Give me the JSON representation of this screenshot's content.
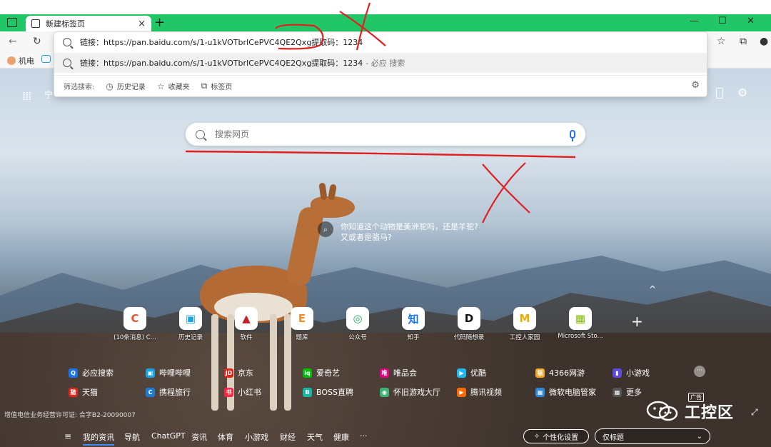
{
  "tab": {
    "title": "新建标签页",
    "close": "×",
    "new": "+"
  },
  "window_controls": {
    "minimize": "—",
    "maximize": "☐",
    "close": "✕"
  },
  "bookmarks": [
    {
      "label": "机电"
    }
  ],
  "omnibox": {
    "input_value": "链接：https://pan.baidu.com/s/1-u1kVOTbrICePVC4QE2Qxg提取码：1234",
    "suggestion": "链接：https://pan.baidu.com/s/1-u1kVOTbrICePVC4QE2Qxg提取码：1234",
    "suggestion_hint": "- 必应 搜索",
    "filter_label": "筛选搜索:",
    "filters": [
      "历史记录",
      "收藏夹",
      "标签页"
    ]
  },
  "page": {
    "city": "宁",
    "search_placeholder": "搜索网页",
    "image_question": "你知道这个动物是美洲驼吗，还是羊驼?又或者是骆马?"
  },
  "quick_links": [
    {
      "label": "(10条消息) C...",
      "glyph": "C",
      "color": "#e4552a"
    },
    {
      "label": "历史记录",
      "glyph": "▣",
      "color": "#19a1e0"
    },
    {
      "label": "软件",
      "glyph": "▲",
      "color": "#c81d25"
    },
    {
      "label": "题库",
      "glyph": "E",
      "color": "#f08a24"
    },
    {
      "label": "公众号",
      "glyph": "◎",
      "color": "#2aae67"
    },
    {
      "label": "知乎",
      "glyph": "知",
      "color": "#1772f6"
    },
    {
      "label": "代码随想录",
      "glyph": "D",
      "color": "#111111"
    },
    {
      "label": "工控人家园",
      "glyph": "M",
      "color": "#f2a900"
    },
    {
      "label": "Microsoft Sto...",
      "glyph": "▦",
      "color": "#7fba00"
    }
  ],
  "sites": [
    {
      "label": "必应搜索",
      "color": "#1a73e8",
      "glyph": "Q"
    },
    {
      "label": "哔哩哔哩",
      "color": "#19a1e0",
      "glyph": "▣"
    },
    {
      "label": "京东",
      "color": "#e1251b",
      "glyph": "JD"
    },
    {
      "label": "爱奇艺",
      "color": "#00be06",
      "glyph": "iq"
    },
    {
      "label": "唯品会",
      "color": "#e4007f",
      "glyph": "唯"
    },
    {
      "label": "优酷",
      "color": "#1eb8f4",
      "glyph": "▶"
    },
    {
      "label": "4366网游",
      "color": "#f5a623",
      "glyph": "猫"
    },
    {
      "label": "小游戏",
      "color": "#5b4bd8",
      "glyph": "▮"
    },
    {
      "label": "天猫",
      "color": "#e1251b",
      "glyph": "猫"
    },
    {
      "label": "携程旅行",
      "color": "#1f7ad4",
      "glyph": "C"
    },
    {
      "label": "小红书",
      "color": "#ff2442",
      "glyph": "书"
    },
    {
      "label": "BOSS直聘",
      "color": "#19b5a5",
      "glyph": "B"
    },
    {
      "label": "怀旧游戏大厅",
      "color": "#3cb371",
      "glyph": "◉"
    },
    {
      "label": "腾讯视频",
      "color": "#ff6a00",
      "glyph": "▶"
    },
    {
      "label": "微软电脑管家",
      "color": "#2b88d8",
      "glyph": "▦"
    },
    {
      "label": "更多",
      "color": "#555555",
      "glyph": "▦"
    }
  ],
  "license": "增值电信业务经营许可证: 合字B2-20090007",
  "bottom_nav": [
    "我的资讯",
    "导航",
    "ChatGPT",
    "资讯",
    "体育",
    "小游戏",
    "财经",
    "天气",
    "健康",
    "···"
  ],
  "personalize": "个性化设置",
  "headline_select": "仅标题",
  "watermark": {
    "text": "工控区",
    "ad": "广告"
  }
}
